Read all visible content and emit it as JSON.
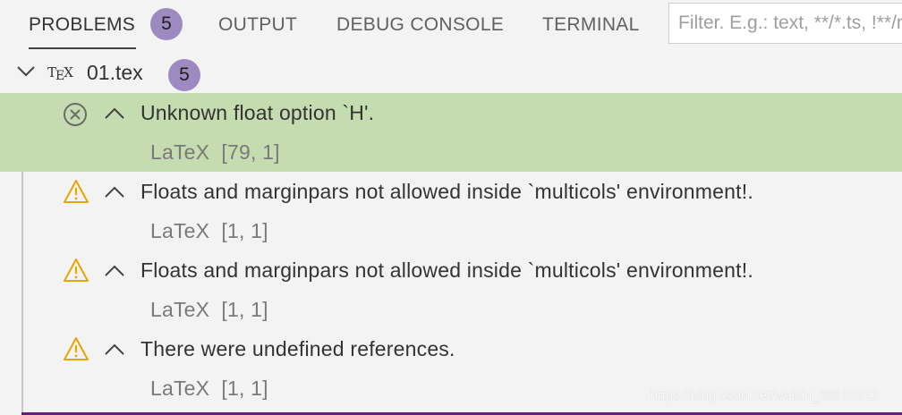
{
  "tabs": {
    "problems": "PROBLEMS",
    "problems_count": "5",
    "output": "OUTPUT",
    "debug_console": "DEBUG CONSOLE",
    "terminal": "TERMINAL"
  },
  "filter": {
    "placeholder": "Filter. E.g.: text, **/*.ts, !**/node_modules/**"
  },
  "file": {
    "icon": "tex-icon",
    "icon_text_t": "T",
    "icon_text_e": "E",
    "icon_text_x": "X",
    "name": "01.tex",
    "count": "5"
  },
  "problems": [
    {
      "severity": "error",
      "icon": "error-icon",
      "message": "Unknown float option `H'.",
      "source": "LaTeX",
      "position": "[79, 1]"
    },
    {
      "severity": "warning",
      "icon": "warning-icon",
      "message": "Floats and marginpars not allowed inside `multicols' environment!.",
      "source": "LaTeX",
      "position": "[1, 1]"
    },
    {
      "severity": "warning",
      "icon": "warning-icon",
      "message": "Floats and marginpars not allowed inside `multicols' environment!.",
      "source": "LaTeX",
      "position": "[1, 1]"
    },
    {
      "severity": "warning",
      "icon": "warning-icon",
      "message": "There were undefined references.",
      "source": "LaTeX",
      "position": "[1, 1]"
    }
  ],
  "watermark": "https://blog.csdn.net/weixin_36815313",
  "colors": {
    "badge": "#9d8ac0",
    "selected_row": "#c4dcb0",
    "warning": "#e8a600",
    "error": "#6b6b6b",
    "panel_border": "#68217a"
  }
}
